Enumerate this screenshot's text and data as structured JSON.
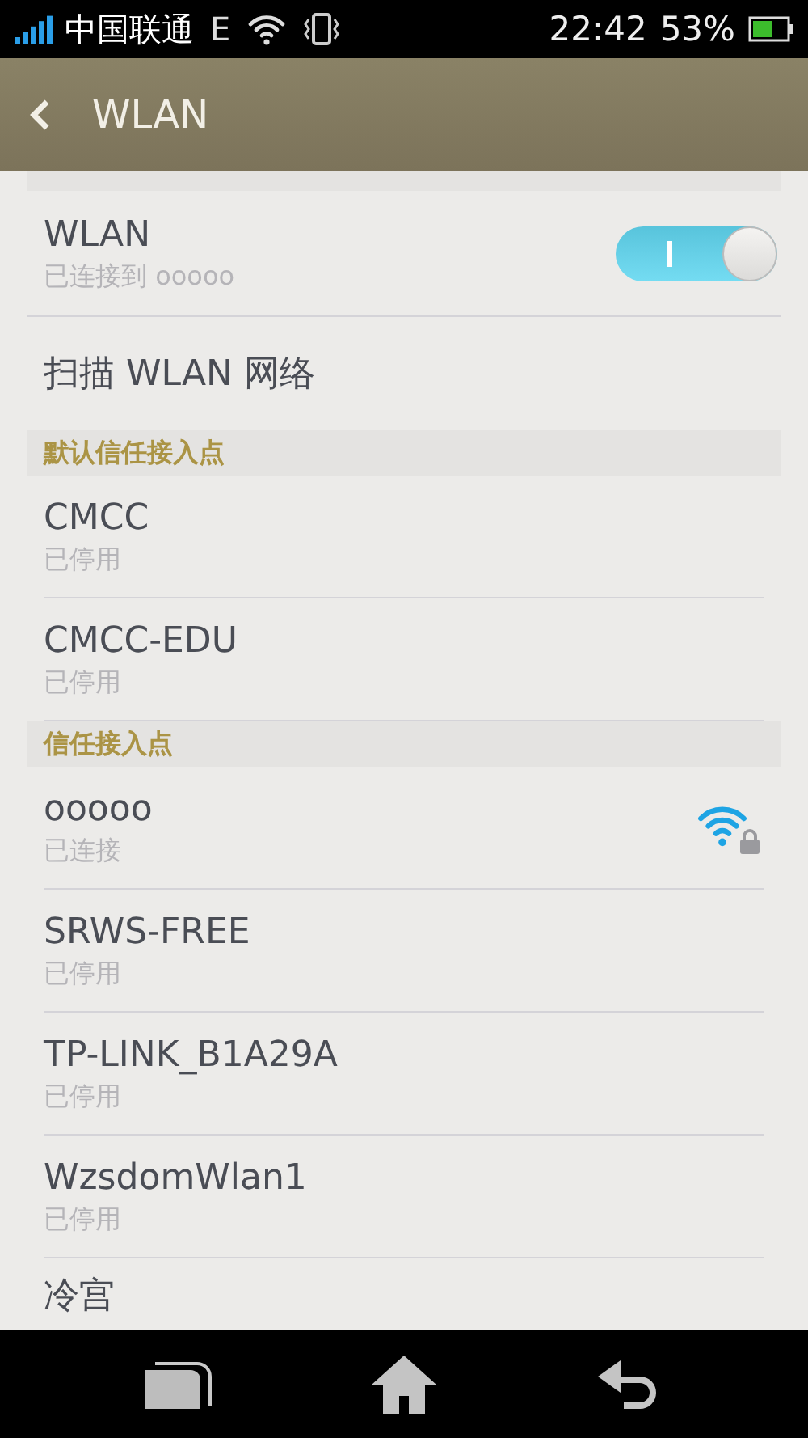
{
  "status_bar": {
    "carrier": "中国联通",
    "network": "E",
    "time": "22:42",
    "battery": "53%"
  },
  "header": {
    "title": "WLAN"
  },
  "wlan": {
    "label": "WLAN",
    "status": "已连接到 ooooo",
    "on": true
  },
  "scan": {
    "label": "扫描 WLAN 网络"
  },
  "sections": [
    {
      "title": "默认信任接入点",
      "networks": [
        {
          "name": "CMCC",
          "status": "已停用",
          "connected": false
        },
        {
          "name": "CMCC-EDU",
          "status": "已停用",
          "connected": false
        }
      ]
    },
    {
      "title": "信任接入点",
      "networks": [
        {
          "name": "ooooo",
          "status": "已连接",
          "connected": true
        },
        {
          "name": "SRWS-FREE",
          "status": "已停用",
          "connected": false
        },
        {
          "name": "TP-LINK_B1A29A",
          "status": "已停用",
          "connected": false
        },
        {
          "name": "WzsdomWlan1",
          "status": "已停用",
          "connected": false
        },
        {
          "name": "冷宫",
          "connected": false
        }
      ]
    }
  ]
}
